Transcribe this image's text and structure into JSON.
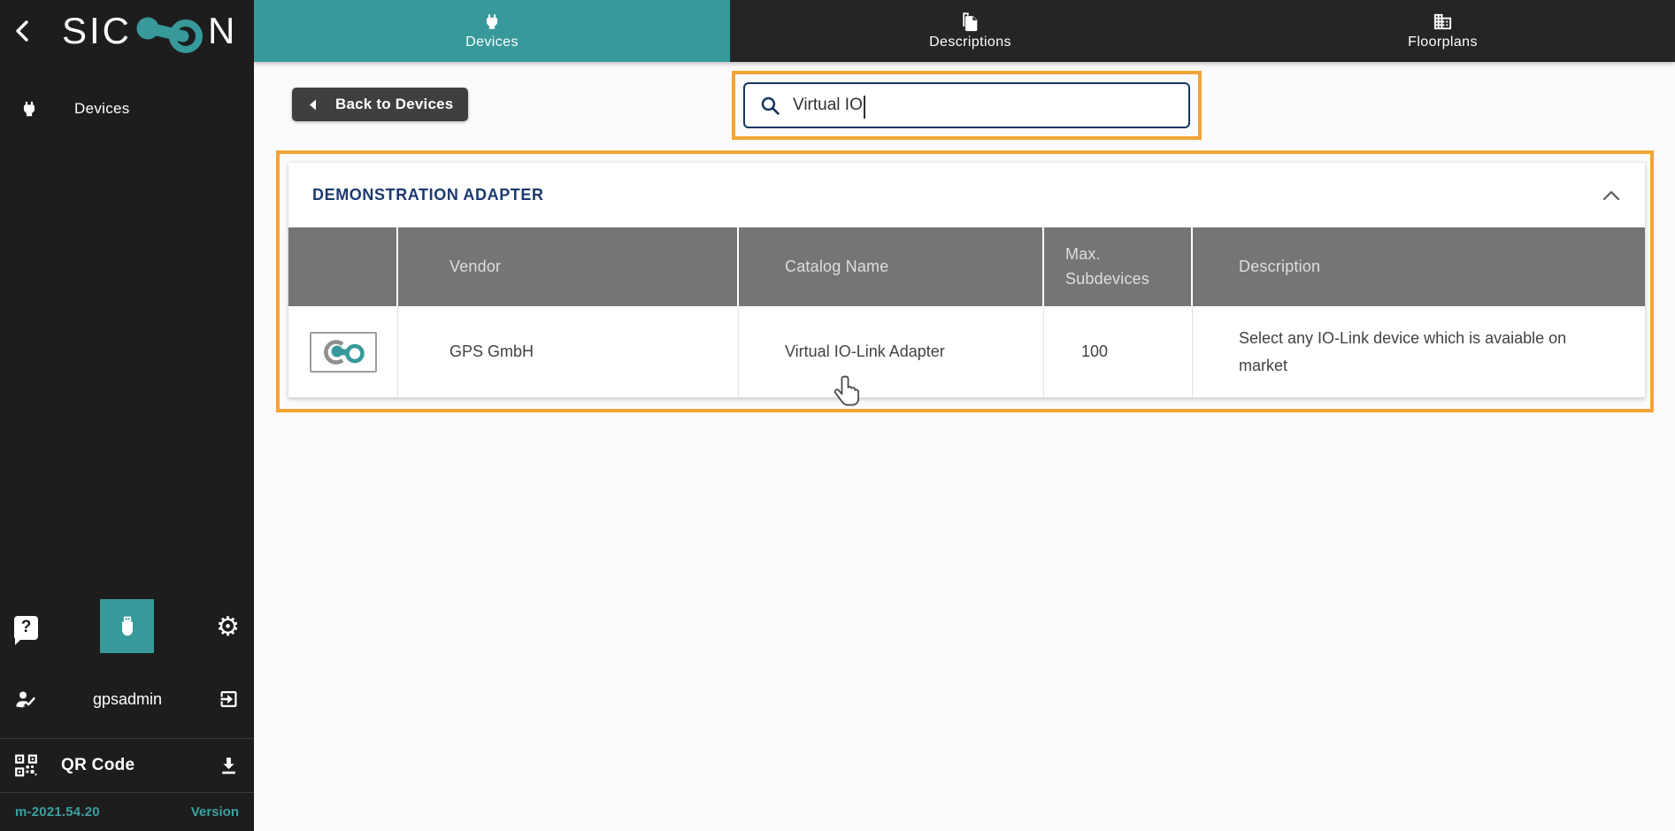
{
  "colors": {
    "teal": "#37999a",
    "orange": "#f2a435",
    "navy_title": "#1c3a70",
    "search_border": "#16365f",
    "table_header_gray": "#757575",
    "sidebar_bg": "#1d1d1e",
    "topbar_bg": "#252527"
  },
  "brand": {
    "text_left": "SIC",
    "text_right": "N"
  },
  "icons": {
    "logo_glyph": "node-link-dumbbell",
    "back_chevron": "chevron-left",
    "plug": "power-plug",
    "descriptions": "document-copy",
    "floorplans": "building",
    "search": "magnifier",
    "help": "question-bubble",
    "usb": "usb-connector",
    "gear": "⚙",
    "user_check": "person-check",
    "logout": "exit-arrow",
    "qr": "qr-grid",
    "download": "download-arrow",
    "collapse": "chevron-up",
    "pointer": "hand-cursor",
    "device_thumb": "sicon-adapter-glyph"
  },
  "sidebar": {
    "nav_devices": "Devices",
    "user_name": "gpsadmin",
    "qr_label": "QR Code",
    "version_value": "m-2021.54.20",
    "version_label": "Version"
  },
  "tabs": [
    {
      "label": "Devices",
      "active": true
    },
    {
      "label": "Descriptions",
      "active": false
    },
    {
      "label": "Floorplans",
      "active": false
    }
  ],
  "toolbar": {
    "back_label": "Back to Devices"
  },
  "search": {
    "value": "Virtual IO"
  },
  "panel": {
    "title": "DEMONSTRATION ADAPTER",
    "columns": {
      "icon": "",
      "vendor": "Vendor",
      "catalog": "Catalog Name",
      "max": "Max. Subdevices",
      "description": "Description"
    },
    "rows": [
      {
        "vendor": "GPS GmbH",
        "catalog": "Virtual IO-Link Adapter",
        "max": "100",
        "description": "Select any IO-Link device which is avaiable on market"
      }
    ]
  }
}
